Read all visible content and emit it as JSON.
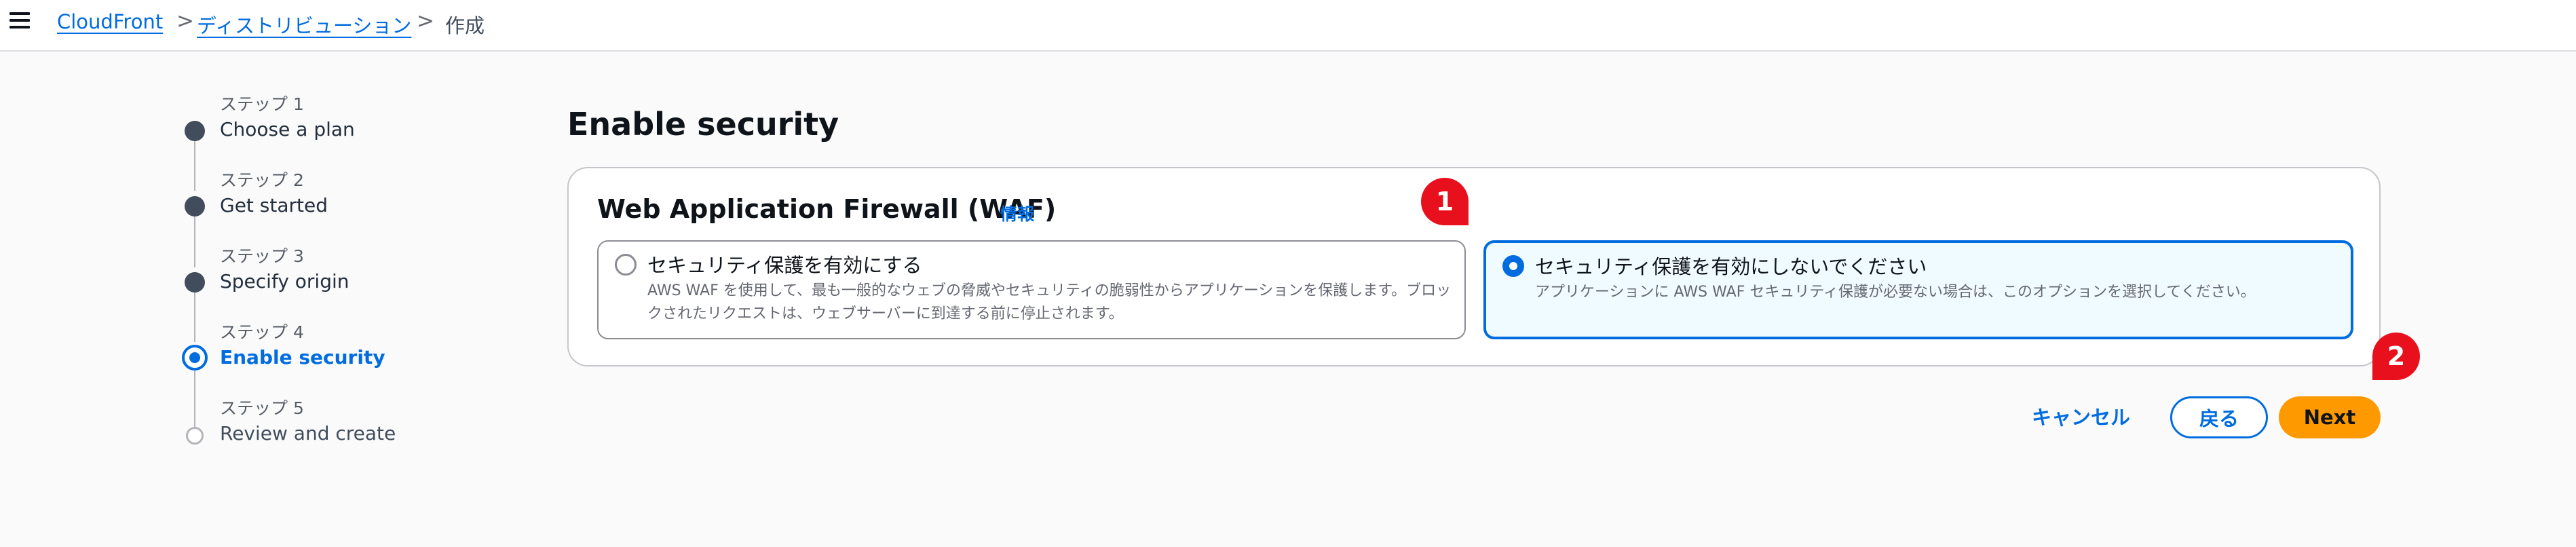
{
  "breadcrumb": {
    "items": [
      "CloudFront",
      "ディストリビューション"
    ],
    "separator": ">",
    "current": "作成"
  },
  "steps": [
    {
      "label": "ステップ 1",
      "title": "Choose a plan",
      "state": "done"
    },
    {
      "label": "ステップ 2",
      "title": "Get started",
      "state": "done"
    },
    {
      "label": "ステップ 3",
      "title": "Specify origin",
      "state": "done"
    },
    {
      "label": "ステップ 4",
      "title": "Enable security",
      "state": "current"
    },
    {
      "label": "ステップ 5",
      "title": "Review and create",
      "state": "future"
    }
  ],
  "page": {
    "title": "Enable security",
    "waf": {
      "title": "Web Application Firewall (WAF)",
      "info_link": "情報",
      "options": [
        {
          "title": "セキュリティ保護を有効にする",
          "description": "AWS WAF を使用して、最も一般的なウェブの脅威やセキュリティの脆弱性からアプリケーションを保護します。ブロックされたリクエストは、ウェブサーバーに到達する前に停止されます。",
          "selected": false
        },
        {
          "title": "セキュリティ保護を有効にしないでください",
          "description": "アプリケーションに AWS WAF セキュリティ保護が必要ない場合は、このオプションを選択してください。",
          "selected": true
        }
      ]
    }
  },
  "actions": {
    "cancel": "キャンセル",
    "back": "戻る",
    "next": "Next"
  },
  "annotations": {
    "marker_1": "1",
    "marker_2": "2"
  },
  "colors": {
    "accent": "#006ce0",
    "primary_button": "#ff9900",
    "marker": "#e8101c",
    "selected_bg": "#f0fbff"
  }
}
